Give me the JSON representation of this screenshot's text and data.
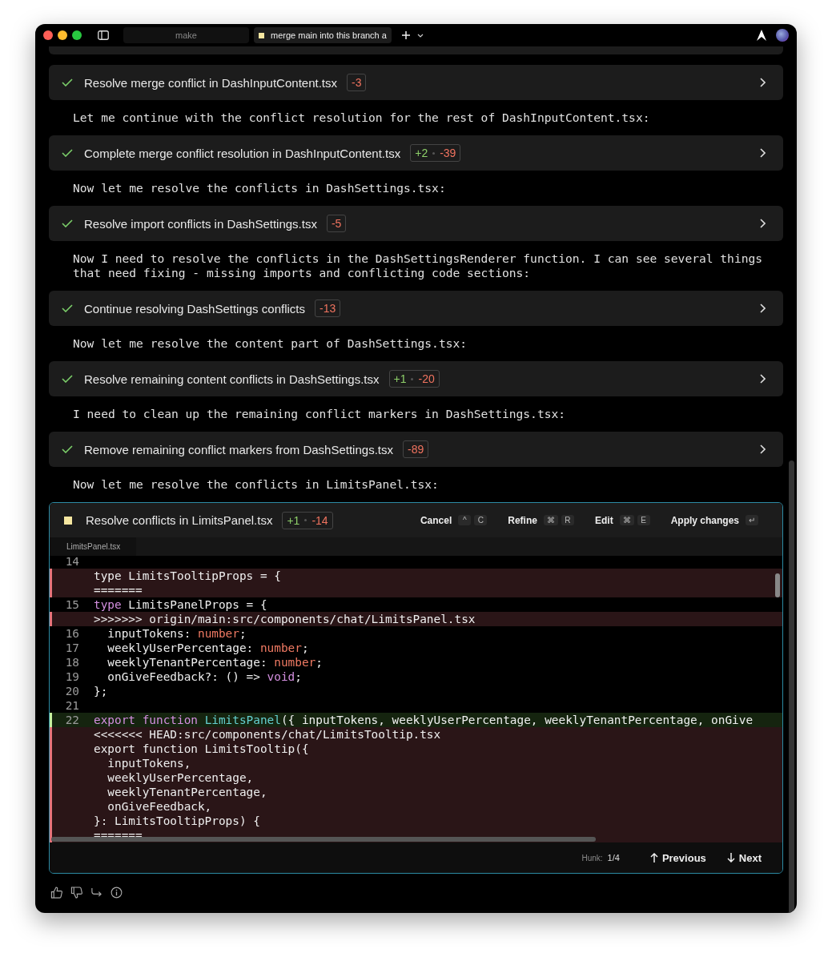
{
  "tabs": [
    {
      "label": "make",
      "selected": false
    },
    {
      "label": "merge main into this branch a",
      "selected": true
    }
  ],
  "feed": [
    {
      "kind": "step",
      "done": true,
      "title": "Resolve merge conflict in DashInputContent.tsx",
      "removed": "-3"
    },
    {
      "kind": "message",
      "text": "Let me continue with the conflict resolution for the rest of DashInputContent.tsx:"
    },
    {
      "kind": "step",
      "done": true,
      "title": "Complete merge conflict resolution in DashInputContent.tsx",
      "added": "+2",
      "removed": "-39"
    },
    {
      "kind": "message",
      "text": "Now let me resolve the conflicts in DashSettings.tsx:"
    },
    {
      "kind": "step",
      "done": true,
      "title": "Resolve import conflicts in DashSettings.tsx",
      "removed": "-5"
    },
    {
      "kind": "message",
      "text": "Now I need to resolve the conflicts in the DashSettingsRenderer function. I can see several things that need fixing - missing imports and conflicting code sections:"
    },
    {
      "kind": "step",
      "done": true,
      "title": "Continue resolving DashSettings conflicts",
      "removed": "-13"
    },
    {
      "kind": "message",
      "text": "Now let me resolve the content part of DashSettings.tsx:"
    },
    {
      "kind": "step",
      "done": true,
      "title": "Resolve remaining content conflicts in DashSettings.tsx",
      "added": "+1",
      "removed": "-20"
    },
    {
      "kind": "message",
      "text": "I need to clean up the remaining conflict markers in DashSettings.tsx:"
    },
    {
      "kind": "step",
      "done": true,
      "title": "Remove remaining conflict markers from DashSettings.tsx",
      "removed": "-89"
    },
    {
      "kind": "message",
      "text": "Now let me resolve the conflicts in LimitsPanel.tsx:"
    }
  ],
  "active_step": {
    "done": false,
    "title": "Resolve conflicts in LimitsPanel.tsx",
    "added": "+1",
    "removed": "-14",
    "actions": [
      {
        "label": "Cancel",
        "keys": [
          "^",
          "C"
        ]
      },
      {
        "label": "Refine",
        "keys": [
          "⌘",
          "R"
        ]
      },
      {
        "label": "Edit",
        "keys": [
          "⌘",
          "E"
        ]
      },
      {
        "label": "Apply changes",
        "keys": [
          "↵"
        ]
      }
    ],
    "file_tab": "LimitsPanel.tsx",
    "code": [
      {
        "number": "14",
        "kind": "context"
      },
      {
        "kind": "removed",
        "text": "type LimitsTooltipProps = {"
      },
      {
        "kind": "removed",
        "text": "======="
      },
      {
        "number": "15",
        "kind": "context",
        "segments": [
          {
            "text": "type",
            "kind": "keyword"
          },
          {
            "text": " LimitsPanelProps = {",
            "kind": "plain"
          }
        ]
      },
      {
        "kind": "removed",
        "text": ">>>>>>> origin/main:src/components/chat/LimitsPanel.tsx"
      },
      {
        "number": "16",
        "kind": "context",
        "segments": [
          {
            "text": "  inputTokens: ",
            "kind": "plain"
          },
          {
            "text": "number",
            "kind": "builtin"
          },
          {
            "text": ";",
            "kind": "plain"
          }
        ]
      },
      {
        "number": "17",
        "kind": "context",
        "segments": [
          {
            "text": "  weeklyUserPercentage: ",
            "kind": "plain"
          },
          {
            "text": "number",
            "kind": "builtin"
          },
          {
            "text": ";",
            "kind": "plain"
          }
        ]
      },
      {
        "number": "18",
        "kind": "context",
        "segments": [
          {
            "text": "  weeklyTenantPercentage: ",
            "kind": "plain"
          },
          {
            "text": "number",
            "kind": "builtin"
          },
          {
            "text": ";",
            "kind": "plain"
          }
        ]
      },
      {
        "number": "19",
        "kind": "context",
        "segments": [
          {
            "text": "  onGiveFeedback?: () => ",
            "kind": "plain"
          },
          {
            "text": "void",
            "kind": "keyword"
          },
          {
            "text": ";",
            "kind": "plain"
          }
        ]
      },
      {
        "number": "20",
        "kind": "context",
        "segments": [
          {
            "text": "};",
            "kind": "plain"
          }
        ]
      },
      {
        "number": "21",
        "kind": "context"
      },
      {
        "number": "22",
        "kind": "added",
        "segments": [
          {
            "text": "export function ",
            "kind": "keyword"
          },
          {
            "text": "LimitsPanel",
            "kind": "name"
          },
          {
            "text": "({ inputTokens, weeklyUserPercentage, weeklyTenantPercentage, onGive",
            "kind": "plain"
          }
        ]
      },
      {
        "kind": "removed",
        "text": "<<<<<<< HEAD:src/components/chat/LimitsTooltip.tsx"
      },
      {
        "kind": "removed",
        "text": "export function LimitsTooltip({"
      },
      {
        "kind": "removed",
        "text": "  inputTokens,"
      },
      {
        "kind": "removed",
        "text": "  weeklyUserPercentage,"
      },
      {
        "kind": "removed",
        "text": "  weeklyTenantPercentage,"
      },
      {
        "kind": "removed",
        "text": "  onGiveFeedback,"
      },
      {
        "kind": "removed",
        "text": "}: LimitsTooltipProps) {"
      },
      {
        "kind": "removed",
        "text": "======="
      }
    ],
    "hunk_label": "Hunk:",
    "hunk": "1/4",
    "nav": [
      {
        "kind": "previous",
        "label": "Previous"
      },
      {
        "kind": "next",
        "label": "Next"
      }
    ]
  }
}
